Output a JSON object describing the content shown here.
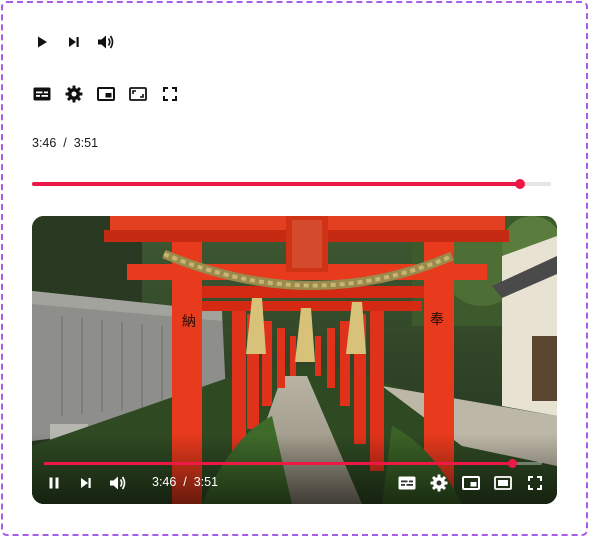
{
  "player": {
    "current_time": "3:46",
    "separator": "/",
    "duration": "3:51",
    "progress_fraction": 0.94
  },
  "colors": {
    "accent": "#ec1845",
    "icon": "#111111",
    "frame_border": "#a55ee8"
  },
  "controls_top": {
    "icons": [
      "play-icon",
      "skip-next-icon",
      "volume-icon"
    ]
  },
  "controls_settings": {
    "icons": [
      "captions-icon",
      "settings-gear-icon",
      "picture-in-picture-icon",
      "theater-mode-icon",
      "fullscreen-icon"
    ]
  },
  "video_controls": {
    "left_icons": [
      "pause-icon",
      "skip-next-icon",
      "volume-icon"
    ],
    "right_icons": [
      "captions-icon",
      "settings-gear-icon",
      "picture-in-picture-icon",
      "theater-mode-icon",
      "fullscreen-icon"
    ]
  }
}
